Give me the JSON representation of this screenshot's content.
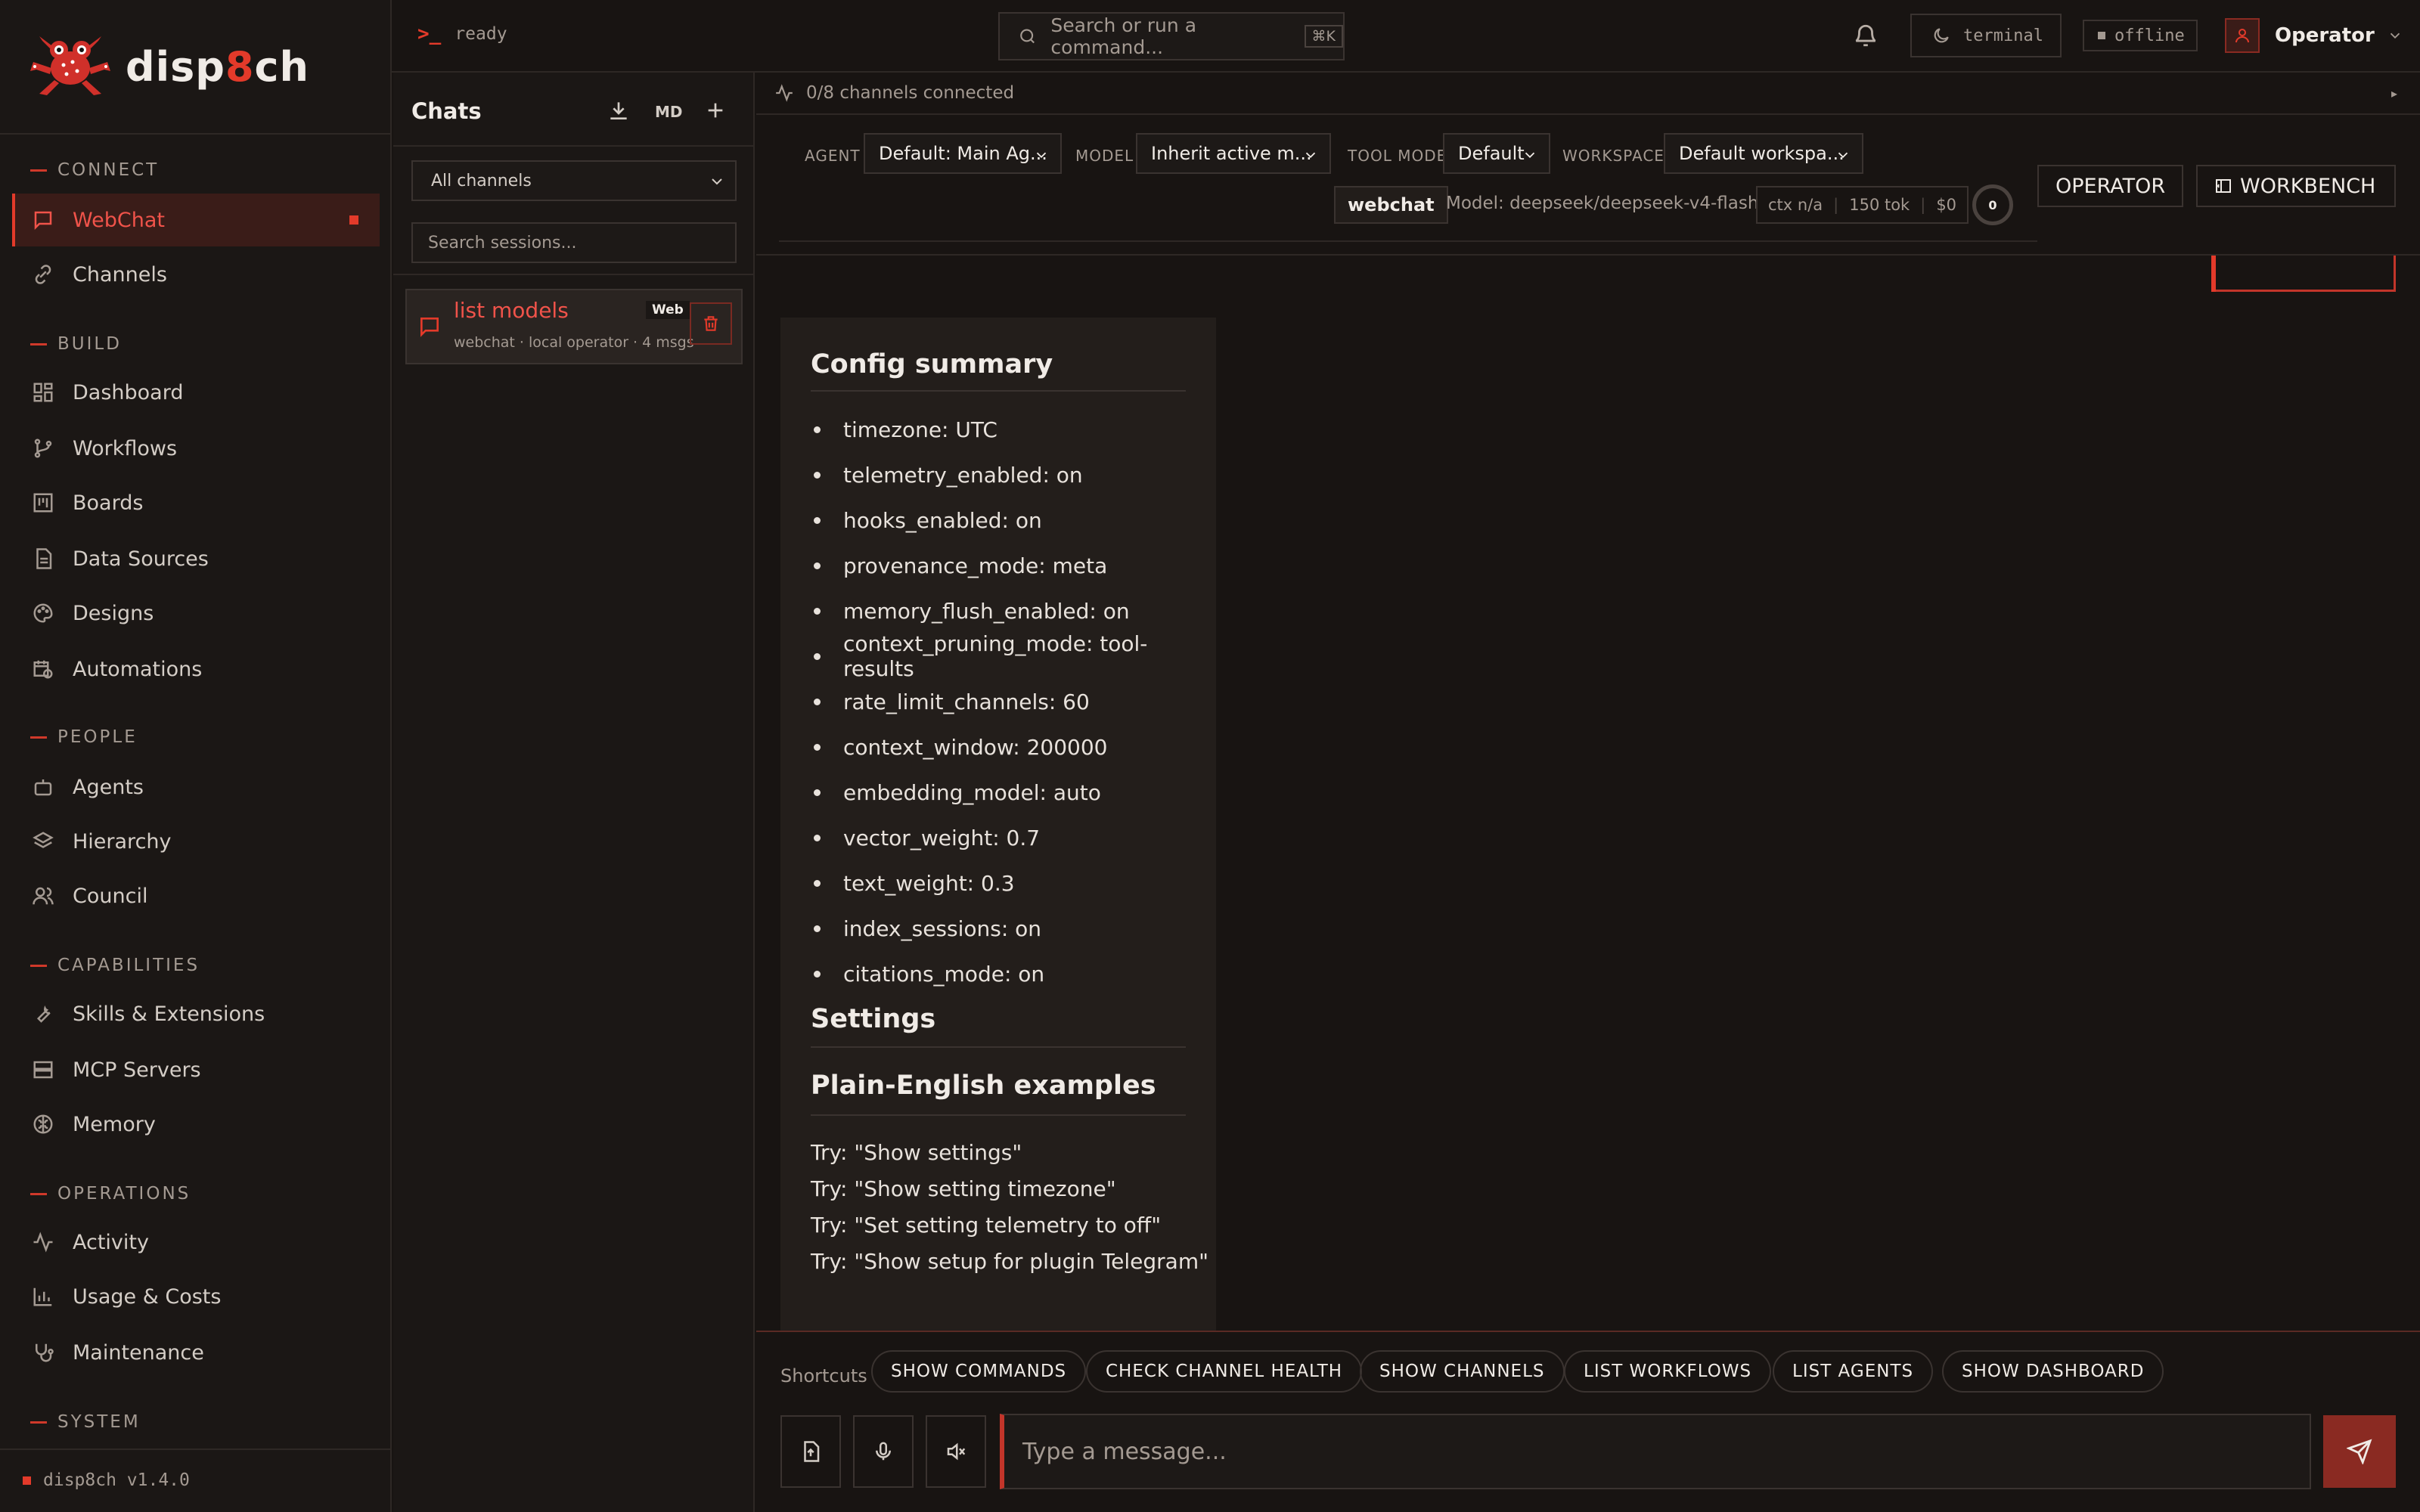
{
  "app": {
    "name_a": "disp",
    "name_b": "8",
    "name_c": "ch",
    "version": "disp8ch v1.4.0"
  },
  "sidebar": {
    "sections": {
      "connect": "CONNECT",
      "build": "BUILD",
      "people": "PEOPLE",
      "capabilities": "CAPABILITIES",
      "operations": "OPERATIONS",
      "system": "SYSTEM"
    },
    "items": {
      "webchat": "WebChat",
      "channels": "Channels",
      "dashboard": "Dashboard",
      "workflows": "Workflows",
      "boards": "Boards",
      "datasources": "Data Sources",
      "designs": "Designs",
      "automations": "Automations",
      "agents": "Agents",
      "hierarchy": "Hierarchy",
      "council": "Council",
      "skills": "Skills & Extensions",
      "mcp": "MCP Servers",
      "memory": "Memory",
      "activity": "Activity",
      "usage": "Usage & Costs",
      "maintenance": "Maintenance"
    }
  },
  "topbar": {
    "status": "ready",
    "search_placeholder": "Search or run a command...",
    "shortcut": "⌘K",
    "theme": "terminal",
    "connection": "offline",
    "user": "Operator"
  },
  "chats": {
    "title": "Chats",
    "md_label": "MD",
    "channel_filter": "All channels",
    "search_placeholder": "Search sessions...",
    "session": {
      "title": "list models",
      "badge": "Web",
      "meta": "webchat · local operator · 4 msgs"
    }
  },
  "main": {
    "connected": "0/8 channels connected",
    "agent_label": "AGENT",
    "agent_value": "Default: Main Ag...",
    "model_label": "MODEL",
    "model_value": "Inherit active m...",
    "toolmode_label": "TOOL MODE",
    "toolmode_value": "Default",
    "workspace_label": "WORKSPACE",
    "workspace_value": "Default workspa...",
    "channel_badge": "webchat",
    "model_info": "Model: deepseek/deepseek-v4-flash",
    "ctx": "ctx n/a",
    "tokens": "150 tok",
    "cost": "$0",
    "ring_value": "0",
    "operator_btn": "OPERATOR",
    "workbench_btn": "WORKBENCH"
  },
  "message": {
    "h_config": "Config summary",
    "config": [
      "timezone: UTC",
      "telemetry_enabled: on",
      "hooks_enabled: on",
      "provenance_mode: meta",
      "memory_flush_enabled: on",
      "context_pruning_mode: tool-results",
      "rate_limit_channels: 60",
      "context_window: 200000",
      "embedding_model: auto",
      "vector_weight: 0.7",
      "text_weight: 0.3",
      "index_sessions: on",
      "citations_mode: on"
    ],
    "h_settings": "Settings",
    "h_examples": "Plain-English examples",
    "examples": [
      "Try: \"Show settings\"",
      "Try: \"Show setting timezone\"",
      "Try: \"Set setting telemetry to off\"",
      "Try: \"Show setup for plugin Telegram\""
    ]
  },
  "composer": {
    "shortcuts_label": "Shortcuts",
    "shortcuts": [
      "SHOW COMMANDS",
      "CHECK CHANNEL HEALTH",
      "SHOW CHANNELS",
      "LIST WORKFLOWS",
      "LIST AGENTS",
      "SHOW DASHBOARD"
    ],
    "placeholder": "Type a message..."
  },
  "colors": {
    "accent": "#e33a2a",
    "background": "#181412",
    "panel": "#1b1715"
  }
}
